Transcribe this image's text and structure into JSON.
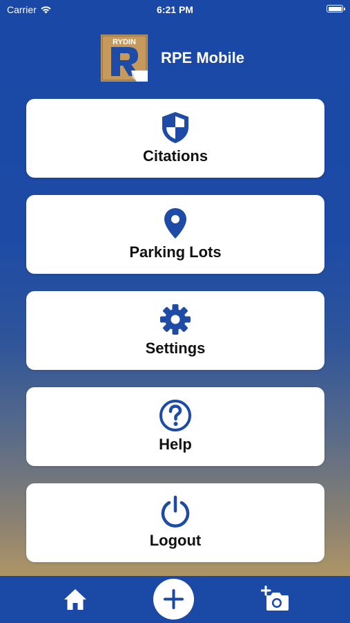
{
  "status_bar": {
    "carrier": "Carrier",
    "time": "6:21 PM"
  },
  "header": {
    "logo_text": "RYDIN",
    "title": "RPE Mobile"
  },
  "menu": [
    {
      "label": "Citations",
      "icon": "shield-icon"
    },
    {
      "label": "Parking Lots",
      "icon": "location-pin-icon"
    },
    {
      "label": "Settings",
      "icon": "gear-icon"
    },
    {
      "label": "Help",
      "icon": "help-circle-icon"
    },
    {
      "label": "Logout",
      "icon": "power-icon"
    }
  ],
  "tab_bar": {
    "items": [
      {
        "icon": "home-icon"
      },
      {
        "icon": "add-icon"
      },
      {
        "icon": "add-photo-icon"
      }
    ]
  },
  "colors": {
    "brand_blue": "#1b4aa6",
    "icon_blue": "#1d4ba5",
    "logo_gold": "#c59a5c"
  }
}
